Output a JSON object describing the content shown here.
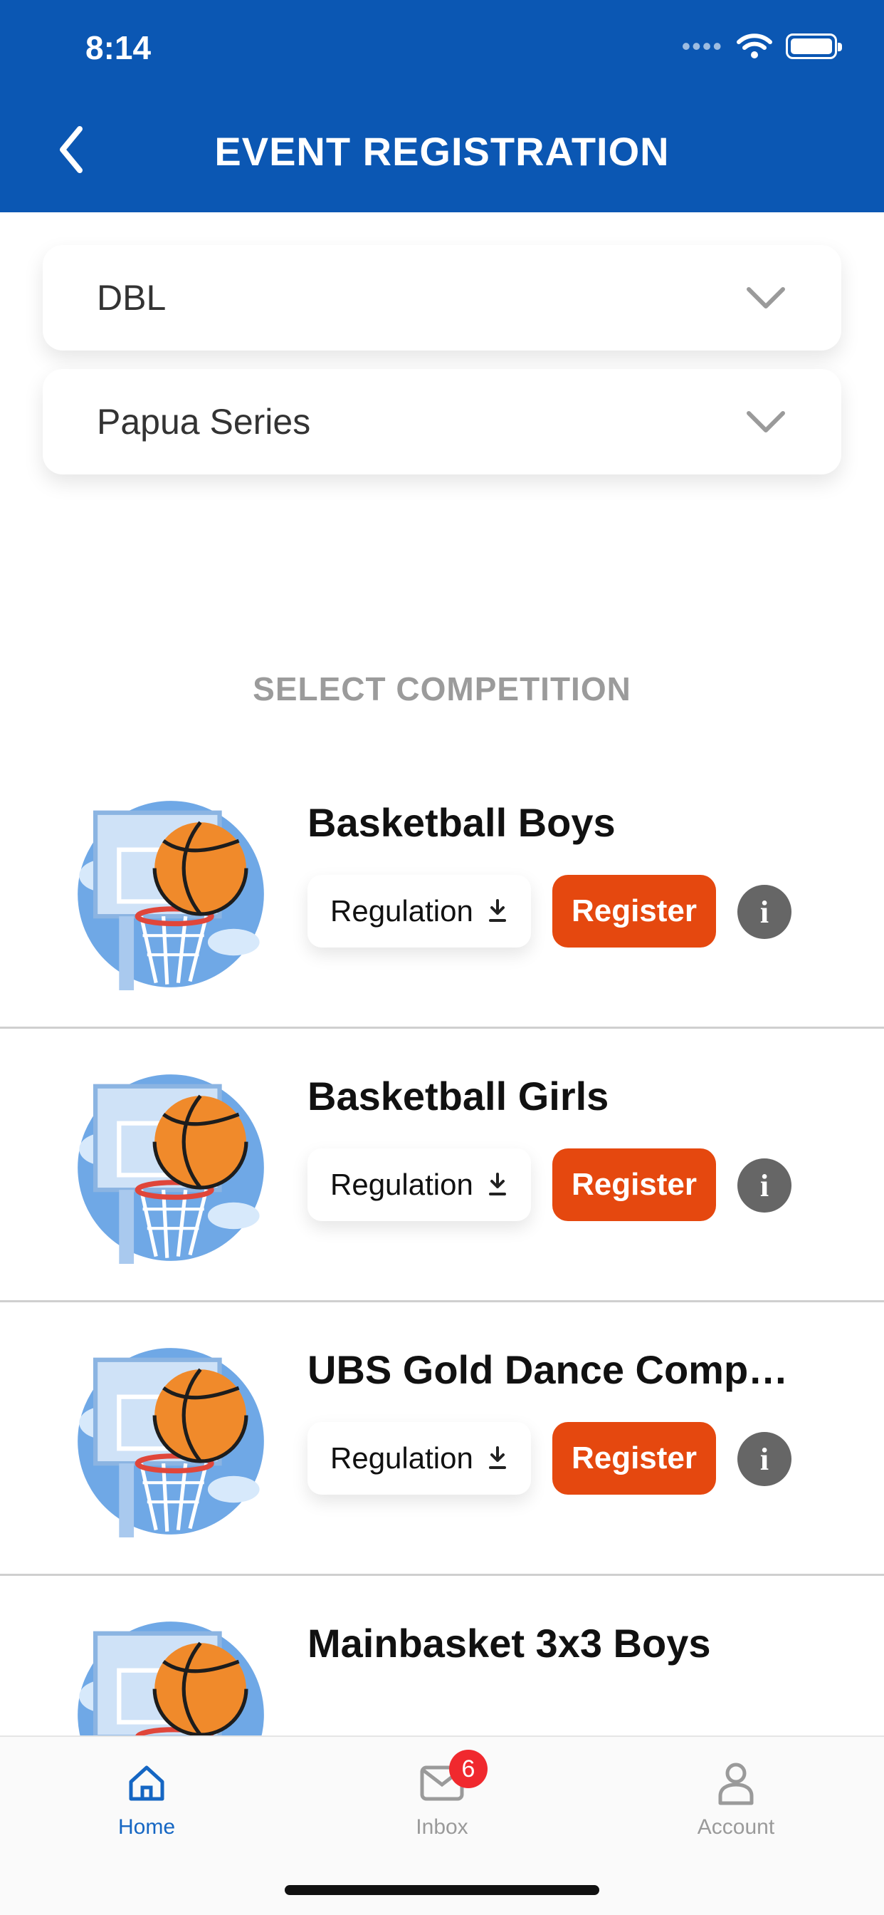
{
  "status_bar": {
    "time": "8:14"
  },
  "header": {
    "title": "EVENT REGISTRATION"
  },
  "dropdowns": [
    {
      "label": "DBL"
    },
    {
      "label": "Papua Series"
    }
  ],
  "section_title": "SELECT COMPETITION",
  "competitions": [
    {
      "name": "Basketball Boys",
      "regulation_label": "Regulation",
      "register_label": "Register",
      "info_label": "i"
    },
    {
      "name": "Basketball Girls",
      "regulation_label": "Regulation",
      "register_label": "Register",
      "info_label": "i"
    },
    {
      "name": "UBS Gold Dance Compet...",
      "regulation_label": "Regulation",
      "register_label": "Register",
      "info_label": "i"
    },
    {
      "name": "Mainbasket 3x3 Boys"
    }
  ],
  "tabbar": {
    "items": [
      {
        "label": "Home",
        "icon": "home-icon",
        "active": true
      },
      {
        "label": "Inbox",
        "icon": "mail-icon",
        "badge": "6"
      },
      {
        "label": "Account",
        "icon": "user-icon"
      }
    ]
  },
  "colors": {
    "header": "#0B57B3",
    "register": "#E5480F",
    "active_tab": "#1566C3",
    "badge": "#F0292E"
  }
}
